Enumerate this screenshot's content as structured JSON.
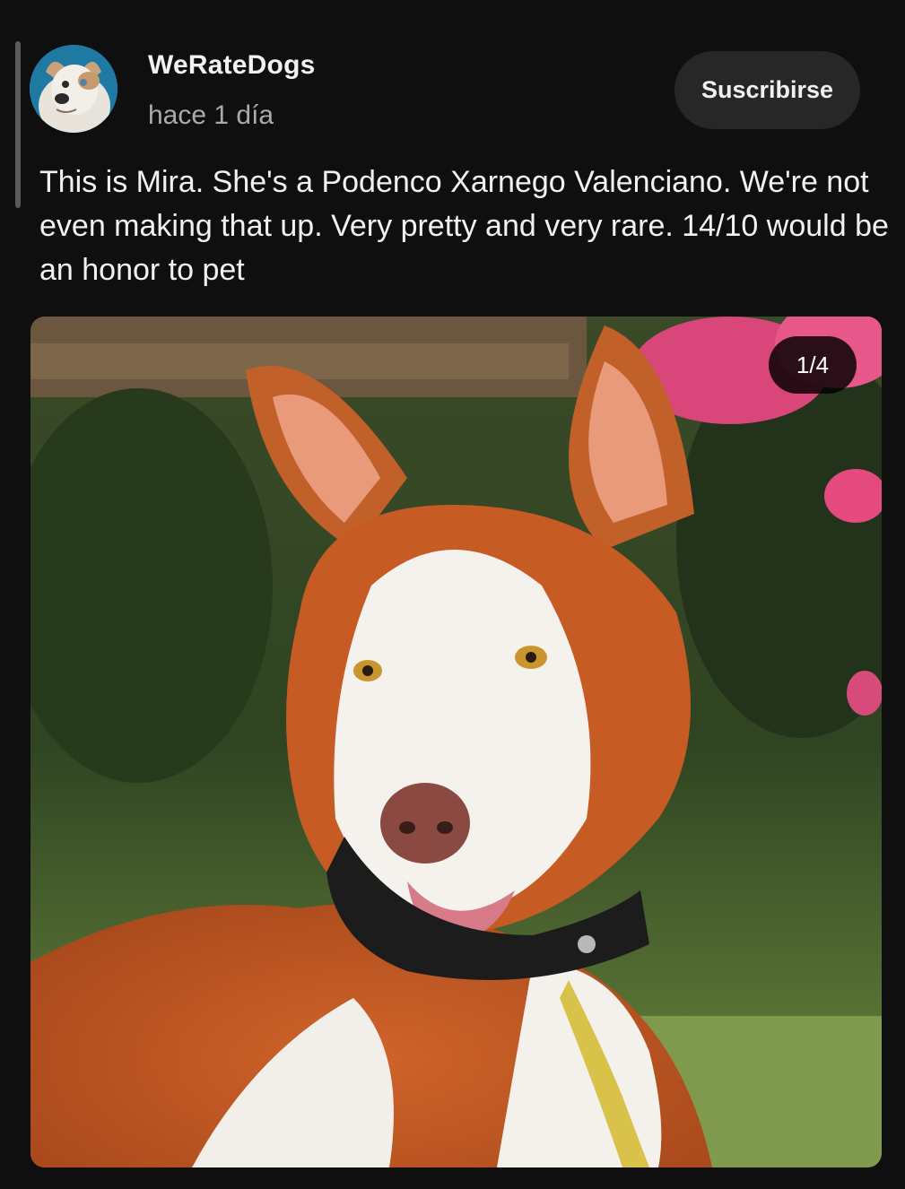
{
  "post": {
    "channel_name": "WeRateDogs",
    "time_ago": "hace 1 día",
    "subscribe_label": "Suscribirse",
    "text": "This is Mira. She's a Podenco Xarnego Valenciano. We're not even making that up. Very pretty and very rare. 14/10 would be an honor to pet"
  },
  "media": {
    "counter": "1/4",
    "current_index": 1,
    "total": 4
  },
  "colors": {
    "background": "#0f0f0f",
    "button_bg": "#272727",
    "secondary_text": "#aaaaaa",
    "primary_text": "#f1f1f1"
  },
  "icons": {
    "avatar": "dog-avatar-icon"
  }
}
